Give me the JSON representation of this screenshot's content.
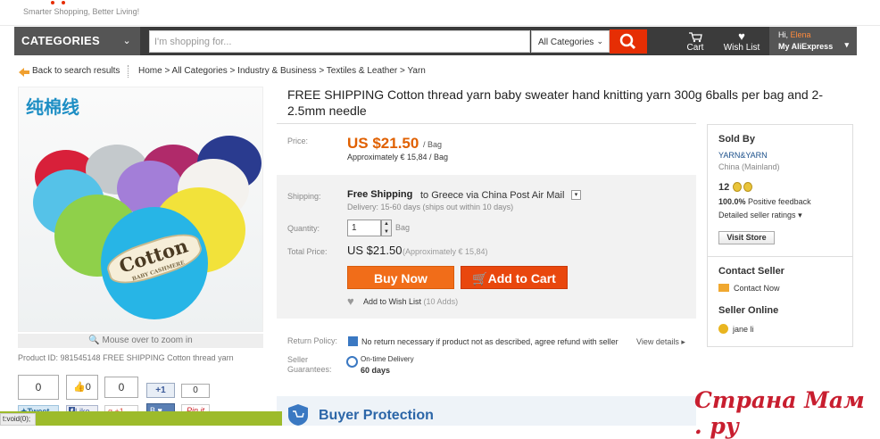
{
  "header": {
    "tagline": "Smarter Shopping, Better Living!",
    "categories_label": "CATEGORIES",
    "search_placeholder": "I'm shopping for...",
    "all_categories": "All Categories",
    "cart_label": "Cart",
    "wishlist_label": "Wish List",
    "greeting_prefix": "Hi,",
    "user_name": "Elena",
    "my_account": "My AliExpress"
  },
  "breadcrumb": {
    "back": "Back to search results",
    "path": "Home > All Categories > Industry & Business > Textiles & Leather > Yarn"
  },
  "gallery": {
    "image_caption": "纯棉线",
    "brand_text": "Cotton",
    "brand_sub": "BABY CASHMERE",
    "zoom_hint": "Mouse over to zoom in",
    "product_id": "Product ID: 981545148 FREE SHIPPING Cotton thread yarn"
  },
  "social": {
    "count1": "0",
    "like_count": "0",
    "count3": "0",
    "plus1": "+1",
    "count4": "0",
    "tweet": "Tweet",
    "like": "Like",
    "gplus": "+1",
    "pinit": "Pin it"
  },
  "product": {
    "title": "FREE SHIPPING Cotton thread yarn baby sweater hand knitting yarn 300g 6balls per bag and 2-2.5mm needle",
    "price_label": "Price:",
    "price": "US $21.50",
    "unit": "/ Bag",
    "approx": "Approximately € 15,84 / Bag",
    "shipping_label": "Shipping:",
    "shipping_free": "Free Shipping",
    "shipping_to": "to  Greece via China Post Air Mail",
    "delivery": "Delivery: 15-60 days (ships out within 10 days)",
    "quantity_label": "Quantity:",
    "quantity": "1",
    "quantity_unit": "Bag",
    "total_label": "Total Price:",
    "total": "US $21.50",
    "total_approx": "(Approximately € 15,84)",
    "buy_now": "Buy Now",
    "add_to_cart": "Add to Cart",
    "wishlist": "Add to Wish List",
    "wishlist_adds": "(10 Adds)",
    "return_label": "Return Policy:",
    "return_text": "No return necessary if product not as described, agree refund with seller",
    "return_link": "View details",
    "guarantee_label1": "Seller",
    "guarantee_label2": "Guarantees:",
    "ontime": "On-time Delivery",
    "ontime_days": "60 days",
    "buyer_protection": "Buyer Protection"
  },
  "seller": {
    "sold_by": "Sold By",
    "store": "YARN&YARN",
    "country": "China (Mainland)",
    "score": "12",
    "positive_pct": "100.0%",
    "positive_label": "Positive feedback",
    "ratings": "Detailed seller ratings",
    "visit": "Visit Store",
    "contact_header": "Contact Seller",
    "contact_now": "Contact Now",
    "online_header": "Seller Online",
    "online_user": "jane li"
  },
  "statusbar": "t:void(0);",
  "watermark": "Страна Мам . ру",
  "colors": {
    "accent_orange": "#e06000",
    "brand_red": "#e62e04",
    "link_blue": "#1a4f8a"
  }
}
